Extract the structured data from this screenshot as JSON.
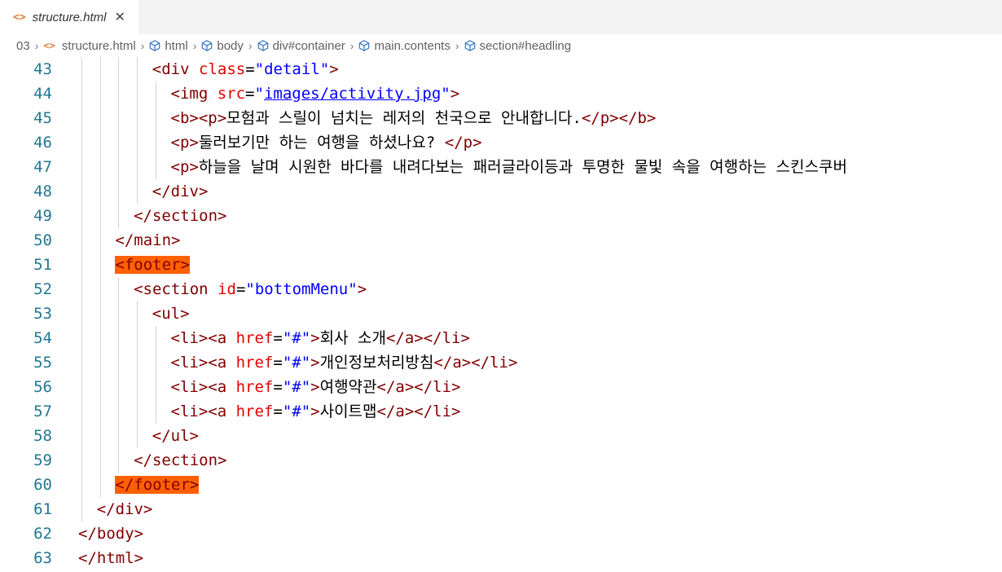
{
  "tab": {
    "icon": "<>",
    "label": "structure.html",
    "close": "✕"
  },
  "breadcrumb": {
    "root": "03",
    "file_icon": "<>",
    "file": "structure.html",
    "items": [
      "html",
      "body",
      "div#container",
      "main.contents",
      "section#headling"
    ]
  },
  "editor": {
    "lines": [
      {
        "n": "43",
        "indent": 4,
        "tokens": [
          [
            "t",
            "<div"
          ],
          [
            "p",
            " "
          ],
          [
            "a",
            "class"
          ],
          [
            "p",
            "="
          ],
          [
            "s",
            "\"detail\""
          ],
          [
            "t",
            ">"
          ]
        ]
      },
      {
        "n": "44",
        "indent": 5,
        "tokens": [
          [
            "t",
            "<img"
          ],
          [
            "p",
            " "
          ],
          [
            "a",
            "src"
          ],
          [
            "p",
            "="
          ],
          [
            "s",
            "\""
          ],
          [
            "u",
            "images/activity.jpg"
          ],
          [
            "s",
            "\""
          ],
          [
            "t",
            ">"
          ]
        ]
      },
      {
        "n": "45",
        "indent": 5,
        "tokens": [
          [
            "t",
            "<b><p>"
          ],
          [
            "x",
            "모험과 스릴이 넘치는 레저의 천국으로 안내합니다."
          ],
          [
            "t",
            "</p></b>"
          ]
        ]
      },
      {
        "n": "46",
        "indent": 5,
        "tokens": [
          [
            "t",
            "<p>"
          ],
          [
            "x",
            "둘러보기만 하는 여행을 하셨나요? "
          ],
          [
            "t",
            "</p>"
          ]
        ]
      },
      {
        "n": "47",
        "indent": 5,
        "tokens": [
          [
            "t",
            "<p>"
          ],
          [
            "x",
            "하늘을 날며 시원한 바다를 내려다보는 패러글라이등과 투명한 물빛 속을 여행하는 스킨스쿠버"
          ]
        ]
      },
      {
        "n": "48",
        "indent": 4,
        "tokens": [
          [
            "t",
            "</div>"
          ]
        ]
      },
      {
        "n": "49",
        "indent": 3,
        "tokens": [
          [
            "t",
            "</section>"
          ]
        ]
      },
      {
        "n": "50",
        "indent": 2,
        "tokens": [
          [
            "t",
            "</main>"
          ]
        ]
      },
      {
        "n": "51",
        "indent": 2,
        "hl": true,
        "tokens": [
          [
            "t",
            "<footer>"
          ]
        ]
      },
      {
        "n": "52",
        "indent": 3,
        "tokens": [
          [
            "t",
            "<section"
          ],
          [
            "p",
            " "
          ],
          [
            "a",
            "id"
          ],
          [
            "p",
            "="
          ],
          [
            "s",
            "\"bottomMenu\""
          ],
          [
            "t",
            ">"
          ]
        ]
      },
      {
        "n": "53",
        "indent": 4,
        "tokens": [
          [
            "t",
            "<ul>"
          ]
        ]
      },
      {
        "n": "54",
        "indent": 5,
        "tokens": [
          [
            "t",
            "<li><a"
          ],
          [
            "p",
            " "
          ],
          [
            "a",
            "href"
          ],
          [
            "p",
            "="
          ],
          [
            "s",
            "\"#\""
          ],
          [
            "t",
            ">"
          ],
          [
            "x",
            "회사 소개"
          ],
          [
            "t",
            "</a></li>"
          ]
        ]
      },
      {
        "n": "55",
        "indent": 5,
        "tokens": [
          [
            "t",
            "<li><a"
          ],
          [
            "p",
            " "
          ],
          [
            "a",
            "href"
          ],
          [
            "p",
            "="
          ],
          [
            "s",
            "\"#\""
          ],
          [
            "t",
            ">"
          ],
          [
            "x",
            "개인정보처리방침"
          ],
          [
            "t",
            "</a></li>"
          ]
        ]
      },
      {
        "n": "56",
        "indent": 5,
        "tokens": [
          [
            "t",
            "<li><a"
          ],
          [
            "p",
            " "
          ],
          [
            "a",
            "href"
          ],
          [
            "p",
            "="
          ],
          [
            "s",
            "\"#\""
          ],
          [
            "t",
            ">"
          ],
          [
            "x",
            "여행약관"
          ],
          [
            "t",
            "</a></li>"
          ]
        ]
      },
      {
        "n": "57",
        "indent": 5,
        "tokens": [
          [
            "t",
            "<li><a"
          ],
          [
            "p",
            " "
          ],
          [
            "a",
            "href"
          ],
          [
            "p",
            "="
          ],
          [
            "s",
            "\"#\""
          ],
          [
            "t",
            ">"
          ],
          [
            "x",
            "사이트맵"
          ],
          [
            "t",
            "</a></li>"
          ]
        ]
      },
      {
        "n": "58",
        "indent": 4,
        "tokens": [
          [
            "t",
            "</ul>"
          ]
        ]
      },
      {
        "n": "59",
        "indent": 3,
        "tokens": [
          [
            "t",
            "</section>"
          ]
        ]
      },
      {
        "n": "60",
        "indent": 2,
        "hl": true,
        "tokens": [
          [
            "t",
            "</footer>"
          ]
        ]
      },
      {
        "n": "61",
        "indent": 1,
        "tokens": [
          [
            "t",
            "</div>"
          ]
        ]
      },
      {
        "n": "62",
        "indent": 0,
        "tokens": [
          [
            "t",
            "</body>"
          ]
        ]
      },
      {
        "n": "63",
        "indent": 0,
        "tokens": [
          [
            "t",
            "</html>"
          ]
        ]
      }
    ]
  }
}
